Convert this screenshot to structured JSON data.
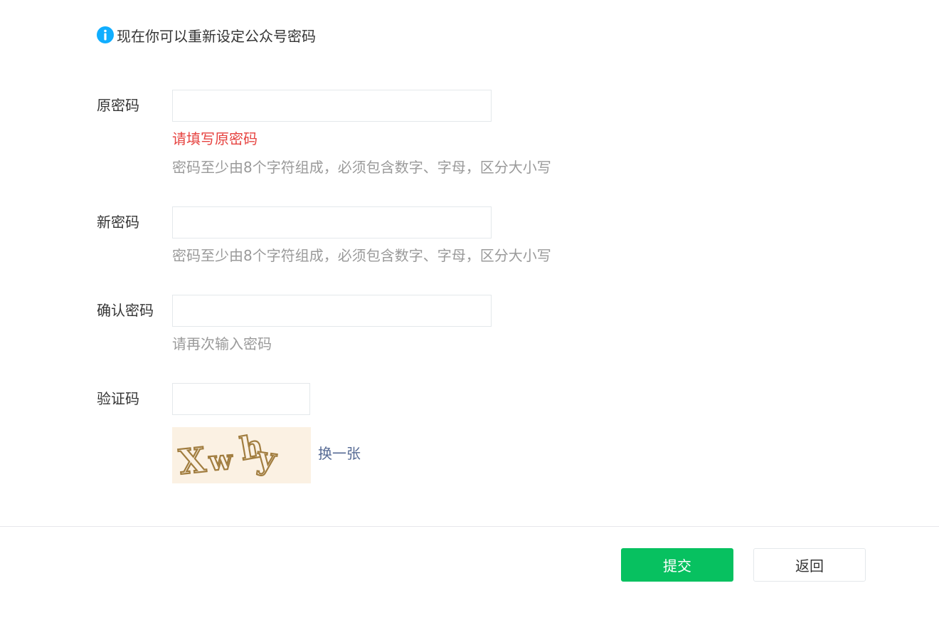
{
  "notice": {
    "icon": "info-icon",
    "text": "现在你可以重新设定公众号密码",
    "icon_color": "#10aeff"
  },
  "form": {
    "old_password": {
      "label": "原密码",
      "value": "",
      "error": "请填写原密码",
      "hint": "密码至少由8个字符组成，必须包含数字、字母，区分大小写"
    },
    "new_password": {
      "label": "新密码",
      "value": "",
      "hint": "密码至少由8个字符组成，必须包含数字、字母，区分大小写"
    },
    "confirm_password": {
      "label": "确认密码",
      "value": "",
      "hint": "请再次输入密码"
    },
    "captcha": {
      "label": "验证码",
      "value": "",
      "image_text": "Xwhy",
      "refresh_label": "换一张"
    }
  },
  "actions": {
    "submit_label": "提交",
    "back_label": "返回"
  },
  "colors": {
    "primary": "#07c160",
    "error": "#e64340",
    "link": "#576b95",
    "hint": "#9a9a9a"
  }
}
